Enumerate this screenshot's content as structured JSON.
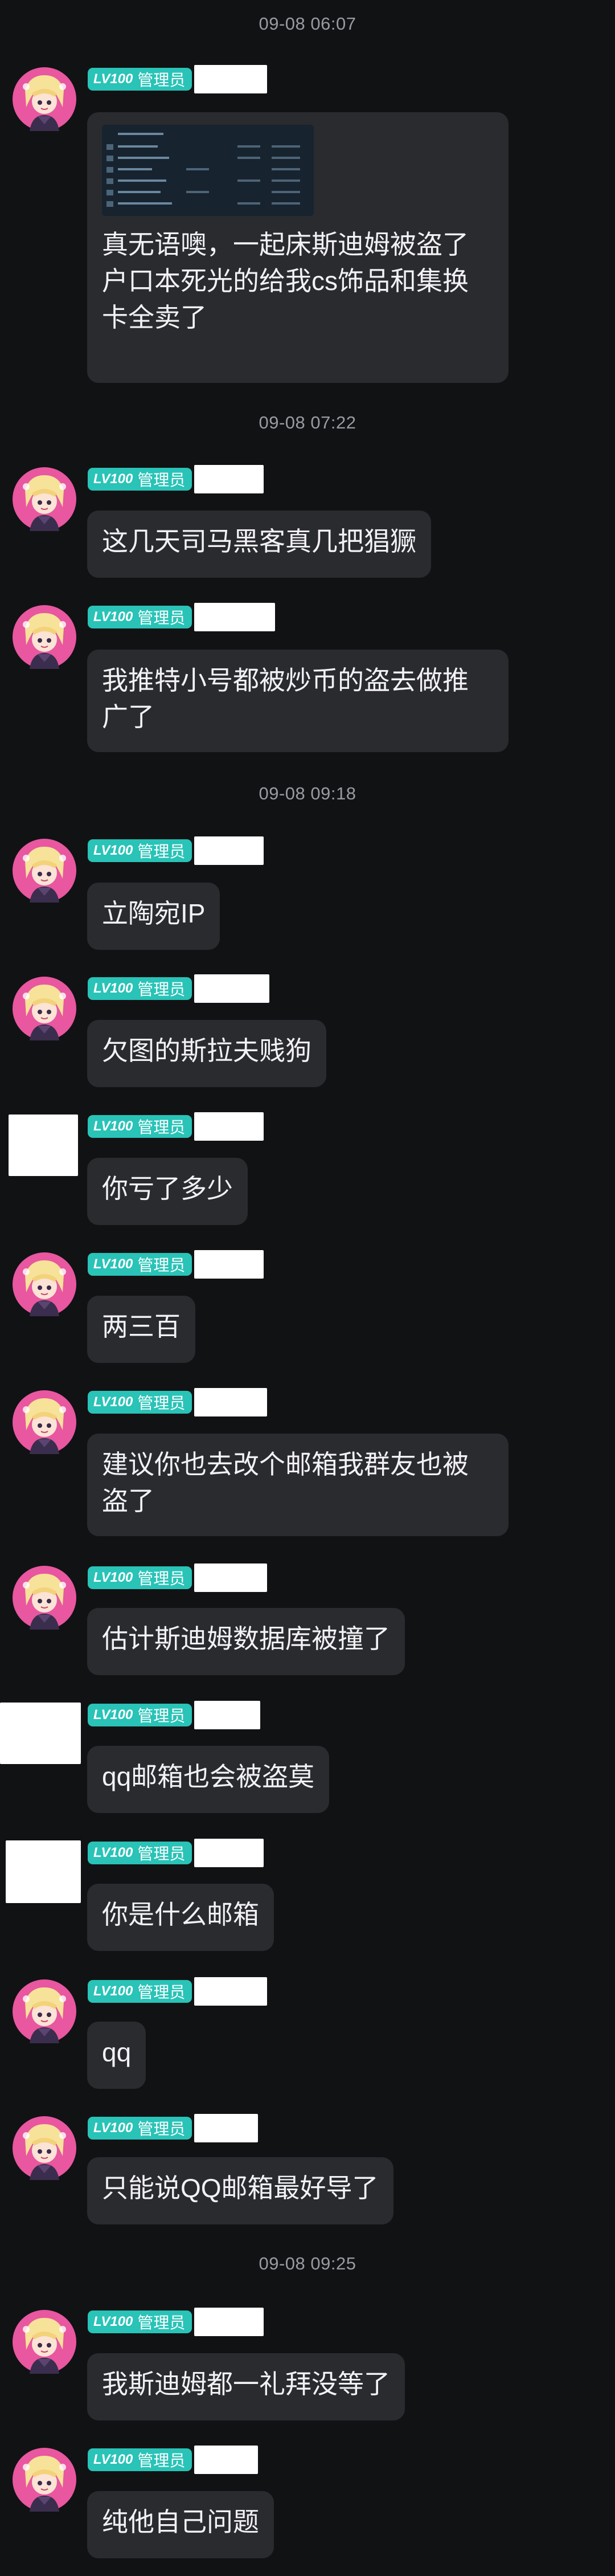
{
  "badge": {
    "level": "LV100",
    "role": "管理员"
  },
  "timestamps": [
    "09-08 06:07",
    "09-08 07:22",
    "09-08 09:18",
    "09-08 09:25"
  ],
  "messages": [
    {
      "text": "真无语噢，一起床斯迪姆被盗了户口本死光的给我cs饰品和集换卡全卖了",
      "has_screenshot": true
    },
    {
      "text": "这几天司马黑客真几把猖獗"
    },
    {
      "text": "我推特小号都被炒币的盗去做推广了"
    },
    {
      "text": "立陶宛IP"
    },
    {
      "text": "欠图的斯拉夫贱狗"
    },
    {
      "text": "你亏了多少"
    },
    {
      "text": "两三百"
    },
    {
      "text": "建议你也去改个邮箱我群友也被盗了"
    },
    {
      "text": "估计斯迪姆数据库被撞了"
    },
    {
      "text": "qq邮箱也会被盗莫"
    },
    {
      "text": "你是什么邮箱"
    },
    {
      "text": "qq"
    },
    {
      "text": "只能说QQ邮箱最好导了"
    },
    {
      "text": "我斯迪姆都一礼拜没等了"
    },
    {
      "text": "纯他自己问题"
    }
  ]
}
